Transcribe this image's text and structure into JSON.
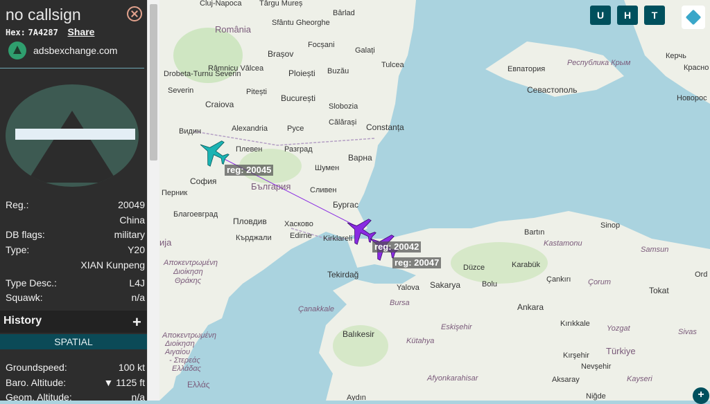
{
  "header": {
    "callsign": "no callsign",
    "hex_label": "Hex:",
    "hex_value": "7A4287",
    "share_label": "Share",
    "source": "adsbexchange.com"
  },
  "details": [
    {
      "key": "Reg.:",
      "value": "20049"
    },
    {
      "key": "",
      "value": "China"
    },
    {
      "key": "DB flags:",
      "value": "military"
    },
    {
      "key": "Type:",
      "value": "Y20"
    },
    {
      "key": "",
      "value": "XIAN Kunpeng"
    },
    {
      "key": "Type Desc.:",
      "value": "L4J"
    },
    {
      "key": "Squawk:",
      "value": "n/a"
    }
  ],
  "history": {
    "title": "History",
    "tab": "SPATIAL"
  },
  "spatial": [
    {
      "key": "Groundspeed:",
      "value": "100 kt"
    },
    {
      "key": "Baro. Altitude:",
      "value": "▼ 1125 ft"
    },
    {
      "key": "Geom. Altitude:",
      "value": "n/a"
    }
  ],
  "map_buttons": {
    "u": "U",
    "h": "H",
    "t": "T"
  },
  "map_labels": {
    "cluj": "Cluj-Napoca",
    "targu": "Târgu Mureș",
    "barlad": "Bârlad",
    "romania": "România",
    "sfantu": "Sfântu Gheorghe",
    "focsani": "Focșani",
    "galati": "Galați",
    "tulcea": "Tulcea",
    "brasov": "Brașov",
    "ploiesti": "Ploiești",
    "buzau": "Buzău",
    "ramnicu": "Râmnicu Vâlcea",
    "drobeta": "Drobeta-Turnu Severin",
    "pitesti": "Pitești",
    "bucuresti": "București",
    "slobozia": "Slobozia",
    "craiova": "Craiova",
    "calarasi": "Călărași",
    "constanta": "Constanța",
    "alexandria": "Alexandria",
    "ruse": "Русе",
    "vidin": "Видин",
    "pleven": "Плевен",
    "razgrad": "Разград",
    "varna": "Варна",
    "shumen": "Шумен",
    "sofia": "София",
    "bulgaria": "България",
    "sliven": "Сливен",
    "pernik": "Перник",
    "burgas": "Бургас",
    "blagoevgrad": "Благоевград",
    "plovdiv": "Пловдив",
    "haskovo": "Хасково",
    "kardzhali": "Кърджали",
    "edirne": "Edirne",
    "kirklareli": "Kirklareli",
    "evpatoriya": "Евпатория",
    "krym": "Республика Крым",
    "kerch": "Керчь",
    "sevastopol": "Севастополь",
    "novoros": "Новорос",
    "krasno": "Красно",
    "bartin": "Bartın",
    "sinop": "Sinop",
    "kastamonu": "Kastamonu",
    "karabuk": "Karabük",
    "samsun": "Samsun",
    "duzce": "Düzce",
    "bolu": "Bolu",
    "cankiri": "Çankırı",
    "corum": "Çorum",
    "ordu": "Ord",
    "tokat": "Tokat",
    "sakarya": "Sakarya",
    "yalova": "Yalova",
    "tekirdag": "Tekirdağ",
    "bursa": "Bursa",
    "canakkale": "Çanakkale",
    "balikesir": "Balıkesir",
    "eskisehir": "Eskişehir",
    "ankara": "Ankara",
    "kirikkale": "Kırıkkale",
    "yozgat": "Yozgat",
    "sivas": "Sivas",
    "kutahya": "Kütahya",
    "kirsehir": "Kırşehir",
    "nevsehir": "Nevşehir",
    "turkiye": "Türkiye",
    "aksaray": "Aksaray",
    "kayseri": "Kayseri",
    "afyon": "Afyonkarahisar",
    "nigde": "Niğde",
    "aydin": "Aydın",
    "ellas": "Ελλάς",
    "ama1": "Αποκεντρωμένη",
    "ama2": "Διοίκηση",
    "ama3": "Θράκης",
    "akeg1": "Αποκεντρωμένη",
    "akeg2": "Διοίκηση",
    "akeg3": "Αιγαίου",
    "akeg4": "- Στερεάς",
    "akeg5": "Ελλάδας",
    "severin": "Severin",
    "makedonija": "ија"
  },
  "aircraft": [
    {
      "reg_label": "reg: 20045",
      "color": "#1ab3b3"
    },
    {
      "reg_label": "reg: 20042",
      "color": "#8a2be2"
    },
    {
      "reg_label": "reg: 20047",
      "color": "#8a2be2"
    }
  ]
}
